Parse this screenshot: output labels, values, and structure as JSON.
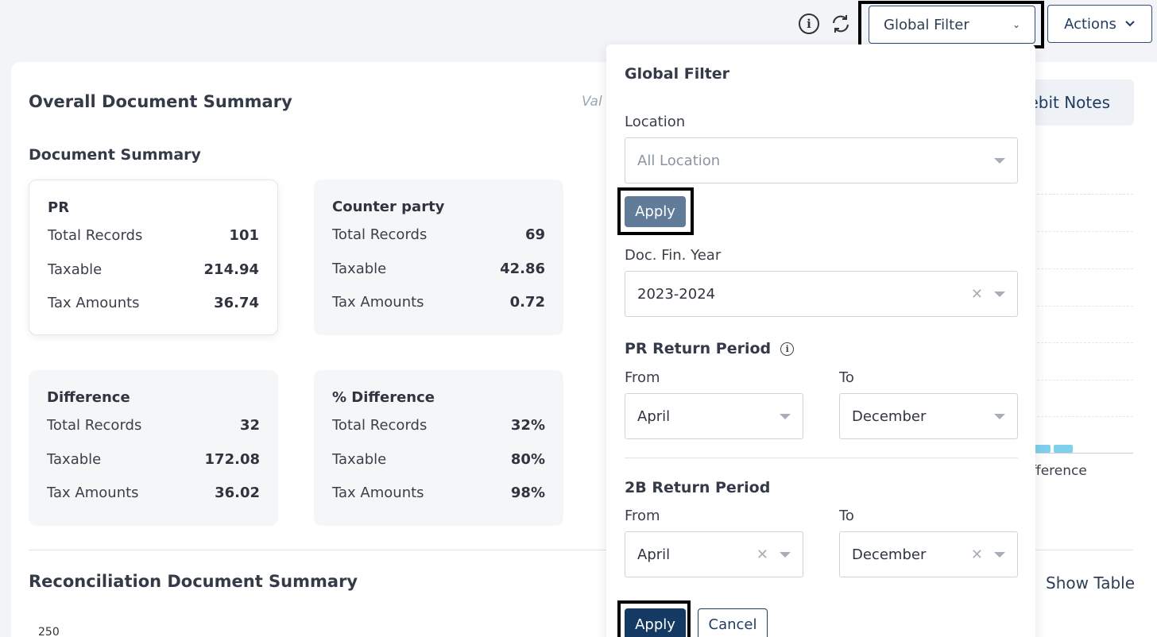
{
  "topbar": {
    "info_icon": "info-icon",
    "refresh_icon": "refresh-icon",
    "global_filter_label": "Global Filter",
    "actions_label": "Actions"
  },
  "main": {
    "title": "Overall Document Summary",
    "value_hint": "Val",
    "tab_label": "ebit Notes",
    "doc_summary_title": "Document Summary",
    "boxes": [
      {
        "title": "PR",
        "rows": [
          {
            "label": "Total Records",
            "value": "101"
          },
          {
            "label": "Taxable",
            "value": "214.94"
          },
          {
            "label": "Tax Amounts",
            "value": "36.74"
          }
        ]
      },
      {
        "title": "Counter party",
        "rows": [
          {
            "label": "Total Records",
            "value": "69"
          },
          {
            "label": "Taxable",
            "value": "42.86"
          },
          {
            "label": "Tax Amounts",
            "value": "0.72"
          }
        ]
      },
      {
        "title": "Difference",
        "rows": [
          {
            "label": "Total Records",
            "value": "32"
          },
          {
            "label": "Taxable",
            "value": "172.08"
          },
          {
            "label": "Tax Amounts",
            "value": "36.02"
          }
        ]
      },
      {
        "title": "% Difference",
        "rows": [
          {
            "label": "Total Records",
            "value": "32%"
          },
          {
            "label": "Taxable",
            "value": "80%"
          },
          {
            "label": "Tax Amounts",
            "value": "98%"
          }
        ]
      }
    ],
    "chart_partial_label": "fference",
    "recon_title": "Reconciliation Document Summary",
    "show_table_label": "Show Table",
    "axis_tick": "250"
  },
  "filter_panel": {
    "title": "Global Filter",
    "location_label": "Location",
    "location_placeholder": "All Location",
    "apply_location_label": "Apply",
    "fin_year_label": "Doc. Fin. Year",
    "fin_year_value": "2023-2024",
    "pr_period_title": "PR Return Period",
    "pr_from_label": "From",
    "pr_from_value": "April",
    "pr_to_label": "To",
    "pr_to_value": "December",
    "b2_period_title": "2B Return Period",
    "b2_from_label": "From",
    "b2_from_value": "April",
    "b2_to_label": "To",
    "b2_to_value": "December",
    "apply_label": "Apply",
    "cancel_label": "Cancel"
  }
}
